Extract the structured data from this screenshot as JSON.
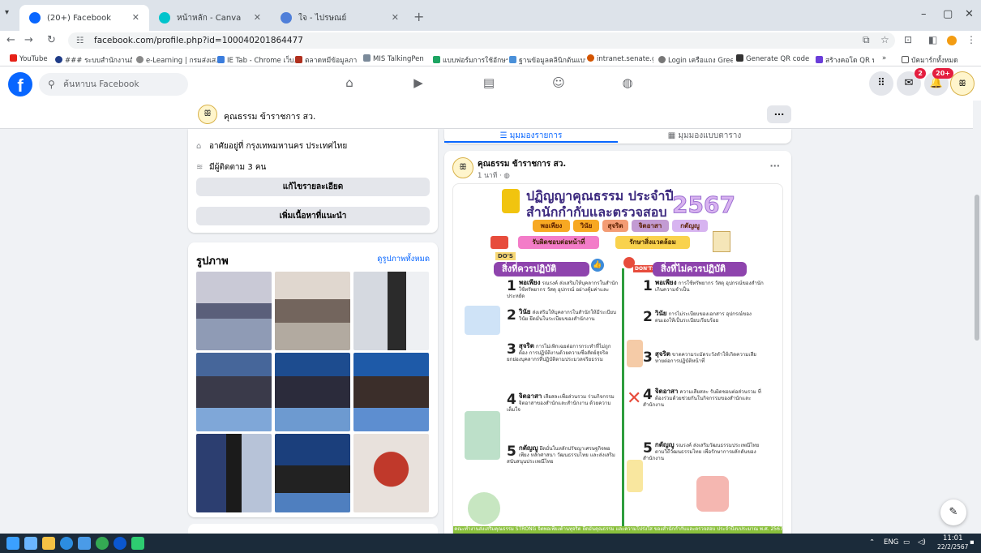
{
  "browser": {
    "tabs": [
      {
        "title": "(20+) Facebook"
      },
      {
        "title": "หน้าหลัก - Canva"
      },
      {
        "title": "ใจ - ไปรษณย์"
      }
    ],
    "url": "facebook.com/profile.php?id=100040201864477",
    "bookmarks": [
      "YouTube",
      "### ระบบสำนักงานอัตโ...",
      "e-Learning | กรมส่งเส...",
      "IE Tab - Chrome เว็บ...",
      "ตลาดหมีข้อมูลภา",
      "MIS TalkingPen",
      "แบบฟอร์มการใช้อักษรา...",
      "ฐานข้อมูลคลินิกต้นแบบรัก...",
      "intranet.senate.go.t...",
      "Login เครือแถง Green",
      "Generate QR code",
      "สร้างคอโด QR ฟรี | สร้า...",
      "บัคมาร์กทั้งหมด"
    ]
  },
  "facebook": {
    "search_placeholder": "ค้นหาบน Facebook",
    "messenger_badge": "2",
    "notif_badge": "20+"
  },
  "profile": {
    "name": "คุณธรรม ข้าราชการ สว.",
    "more": "..."
  },
  "intro": {
    "lives": "อาศัยอยู่ที่ กรุงเทพมหานคร ประเทศไทย",
    "followers": "มีผู้ติดตาม 3 คน",
    "edit_details": "แก้ไขรายละเอียด",
    "add_featured": "เพิ่มเนื้อหาที่แนะนำ"
  },
  "photos": {
    "title": "รูปภาพ",
    "see_all": "ดูรูปภาพทั้งหมด"
  },
  "view_tabs": {
    "list": "มุมมองรายการ",
    "grid": "มุมมองแบบตาราง"
  },
  "post": {
    "author": "คุณธรรม ข้าราชการ สว.",
    "time": "1 นาที · ",
    "poster": {
      "title1": "ปฏิญญาคุณธรรม ประจำปี",
      "title2": "สำนักกำกับและตรวจสอบ",
      "year": "2567",
      "virtues": [
        "พอเพียง",
        "วินัย",
        "สุจริต",
        "จิตอาสา",
        "กตัญญู"
      ],
      "values2": [
        "รับผิดชอบต่อหน้าที่",
        "รักษาสิ่งแวดล้อม"
      ],
      "dos_tag": "DO'S",
      "donts_tag": "DON'TS",
      "dos": "สิ่งที่ควรปฏิบัติ",
      "donts": "สิ่งที่ไม่ควรปฏิบัติ",
      "dos_items": [
        {
          "n": "1",
          "h": "พอเพียง",
          "t": "รณรงค์ ส่งเสริมให้บุคลากรในสำนักใช้ทรัพยากร วัสดุ อุปกรณ์ อย่างคุ้มค่าและประหยัด"
        },
        {
          "n": "2",
          "h": "วินัย",
          "t": "ส่งเสริมให้บุคลากรในสำนักให้มีระเบียบ วินัย ยึดมั่นในระเบียบของสำนักงาน"
        },
        {
          "n": "3",
          "h": "สุจริต",
          "t": "การไม่เพิกเฉยต่อการกระทำที่ไม่ถูกต้อง การปฏิบัติงานด้วยความซื่อสัตย์สุจริต ยกย่องบุคลากรที่ปฏิบัติตามประมวลจริยธรรม"
        },
        {
          "n": "4",
          "h": "จิตอาสา",
          "t": "เสียสละเพื่อส่วนรวม ร่วมกิจกรรมจิตอาสาของสำนักและสำนักงาน ด้วยความเต็มใจ"
        },
        {
          "n": "5",
          "h": "กตัญญู",
          "t": "ยึดมั่นในหลักปรัชญาเศรษฐกิจพอเพียง หลักศาสนา วัฒนธรรมไทย และส่งเสริมสนับสนุนประเพณีไทย"
        }
      ],
      "dont_items": [
        {
          "n": "1",
          "h": "พอเพียง",
          "t": "การใช้ทรัพยากร วัสดุ อุปกรณ์ของสำนักเกินความจำเป็น"
        },
        {
          "n": "2",
          "h": "วินัย",
          "t": "การไม่ระเบียบของเอกสาร อุปกรณ์ของตนเองให้เป็นระเบียบเรียบร้อย"
        },
        {
          "n": "3",
          "h": "สุจริต",
          "t": "ขาดความระมัดระวังทำให้เกิดความเสียหายต่อการปฏิบัติหน้าที่"
        },
        {
          "n": "4",
          "h": "จิตอาสา",
          "t": "ความเสียสละ รับผิดชอบต่อส่วนรวม ที่ต้องร่วมด้วยช่วยกันในกิจกรรมของสำนักและสำนักงาน"
        },
        {
          "n": "5",
          "h": "กตัญญู",
          "t": "รณรงค์ ส่งเสริมวัฒนธรรมประเพณีไทย ตามวิถีวัฒนธรรมไทย เพื่อรักษาการผลักดันของสำนักงาน"
        }
      ],
      "footer": "คณะทำงานส่งเสริมคุณธรรม STRONG จิตพอเพียงต้านทุจริต ยึดมั่นคุณธรรม และความโปร่งใส ของสำนักกำกับและตรวจสอบ ประจำปีงบประมาณ พ.ศ. 2567"
    }
  },
  "taskbar": {
    "lang": "ENG",
    "time": "11:01",
    "date": "22/2/2567"
  }
}
